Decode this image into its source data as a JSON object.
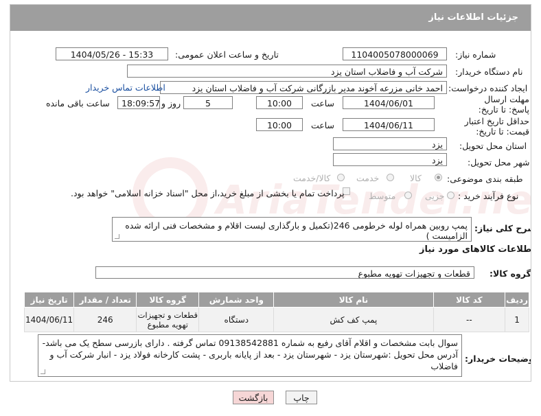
{
  "header": {
    "title": "جزئیات اطلاعات نیاز"
  },
  "form": {
    "need_number": {
      "label": "شماره نیاز:",
      "value": "1104005078000069"
    },
    "announce_datetime": {
      "label": "تاریخ و ساعت اعلان عمومی:",
      "value": "1404/05/26 - 15:33"
    },
    "buyer_org": {
      "label": "نام دستگاه خریدار:",
      "value": "شرکت آب و فاضلاب استان یزد"
    },
    "requester": {
      "label": "ایجاد کننده درخواست:",
      "value": "احمد خانی مزرعه آخوند مدیر بازرگانی شرکت آب و فاضلاب استان یزد",
      "contact_link": "اطلاعات تماس خریدار"
    },
    "deadline": {
      "label": "مهلت ارسال پاسخ: تا تاریخ:",
      "date": "1404/06/01",
      "time_label": "ساعت",
      "time": "10:00",
      "days": "5",
      "days_label": "روز و",
      "remaining": "18:09:57",
      "remaining_label": "ساعت باقی مانده"
    },
    "price_validity": {
      "label": "حداقل تاریخ اعتبار قیمت: تا تاریخ:",
      "date": "1404/06/11",
      "time_label": "ساعت",
      "time": "10:00"
    },
    "province": {
      "label": "استان محل تحویل:",
      "value": "یزد"
    },
    "city": {
      "label": "شهر محل تحویل:",
      "value": "یزد"
    },
    "category": {
      "label": "طبقه بندی موضوعی:",
      "options": [
        "کالا",
        "خدمت",
        "کالا/خدمت"
      ],
      "selected": "کالا"
    },
    "process": {
      "label": "نوع فرآیند خرید :",
      "options": [
        "جزیی",
        "متوسط"
      ],
      "selected": "",
      "payment_note": "پرداخت تمام یا بخشی از مبلغ خرید،از محل \"اسناد خزانه اسلامی\" خواهد بود."
    },
    "description": {
      "label": "شرح کلی نیاز:",
      "value": "پمپ روبین همراه لوله خرطومی 246(تکمیل و بارگذاری لیست اقلام و مشخصات فنی ارائه شده الزامیست )"
    }
  },
  "goods_section": {
    "title": "اطلاعات کالاهای مورد نیاز",
    "group_label": "گروه کالا:",
    "group_value": "قطعات و تجهیزات تهویه مطبوع"
  },
  "table": {
    "columns": [
      "ردیف",
      "کد کالا",
      "نام کالا",
      "واحد شمارش",
      "گروه کالا",
      "تعداد / مقدار",
      "تاریخ نیاز"
    ],
    "rows": [
      [
        "1",
        "--",
        "پمپ کف کش",
        "دستگاه",
        "قطعات و تجهیزات تهویه مطبوع",
        "246",
        "1404/06/11"
      ]
    ]
  },
  "buyer_notes": {
    "label": "توضیحات خریدار:",
    "value": "سوال بابت مشخصات و اقلام آقای رفیع به شماره 09138542881 تماس گرفته . دارای بازرسی سطح یک می باشد- آدرس محل تحویل :شهرستان یزد - شهرستان یزد - بعد از پایانه باربری - پشت کارخانه فولاد یزد - انبار شرکت آب و فاضلاب"
  },
  "buttons": {
    "print": "چاپ",
    "back": "بازگشت"
  },
  "watermark": {
    "text": "AriaTender.net"
  },
  "colors": {
    "header_bg": "#9e9e9e",
    "link": "#1a4fa0",
    "back_button": "#f6d6d6",
    "print_button": "#f3f3f3"
  }
}
